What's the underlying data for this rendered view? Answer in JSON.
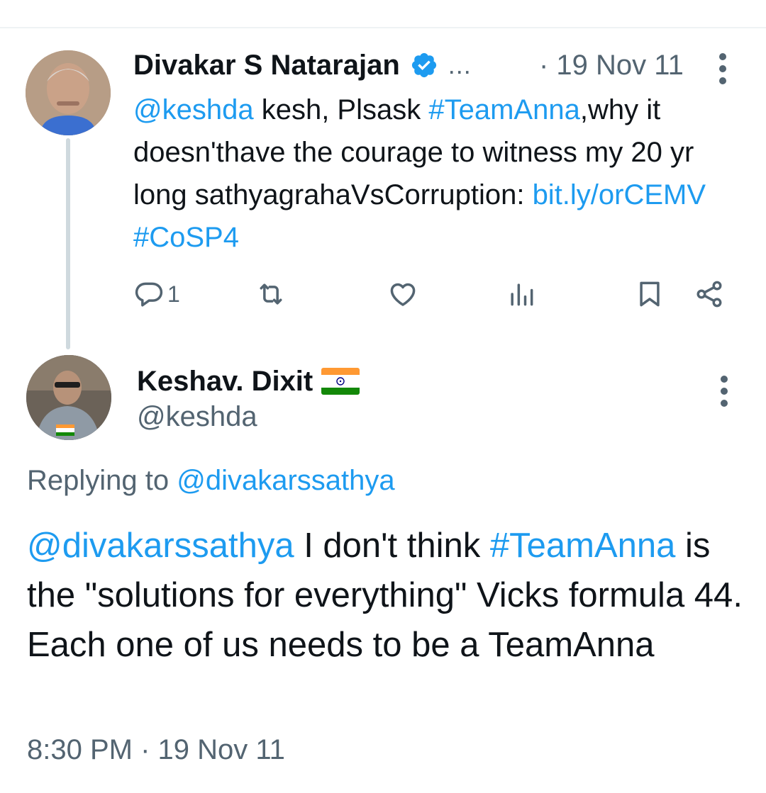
{
  "thread": {
    "parent_tweet": {
      "author_name": "Divakar S Natarajan",
      "verified": true,
      "truncation": "...",
      "date": "· 19 Nov 11",
      "segments": [
        {
          "text": "@keshda",
          "type": "mention"
        },
        {
          "text": " kesh, Plsask ",
          "type": "text"
        },
        {
          "text": "#TeamAnna",
          "type": "hashtag"
        },
        {
          "text": ",why it doesn'thave the courage to witness my 20 yr long sathyagrahaVsCorruption: ",
          "type": "text"
        },
        {
          "text": "bit.ly/orCEMV",
          "type": "link"
        },
        {
          "text": " ",
          "type": "text"
        },
        {
          "text": "#CoSP4",
          "type": "hashtag"
        }
      ],
      "actions": {
        "reply_count": "1",
        "retweet_count": "",
        "like_count": "",
        "views_count": ""
      }
    },
    "reply_tweet": {
      "author_name": "Keshav. Dixit",
      "author_flag": "india-flag",
      "handle": "@keshda",
      "replying_to_prefix": "Replying to ",
      "replying_to": "@divakarssathya",
      "segments": [
        {
          "text": "@divakarssathya",
          "type": "mention"
        },
        {
          "text": " I don't think ",
          "type": "text"
        },
        {
          "text": "#TeamAnna",
          "type": "hashtag"
        },
        {
          "text": " is the \"solutions for everything\" Vicks formula 44. Each one of us needs to be a TeamAnna",
          "type": "text"
        }
      ],
      "timestamp": "8:30 PM · 19 Nov 11"
    }
  },
  "icons": [
    "verified-badge-icon",
    "more-icon",
    "reply-icon",
    "retweet-icon",
    "like-icon",
    "views-icon",
    "bookmark-icon",
    "share-icon",
    "india-flag-icon"
  ],
  "colors": {
    "link": "#1d9bf0",
    "text": "#0f1419",
    "secondary": "#536471",
    "thread_line": "#cfd9de",
    "divider": "#eff3f4"
  }
}
